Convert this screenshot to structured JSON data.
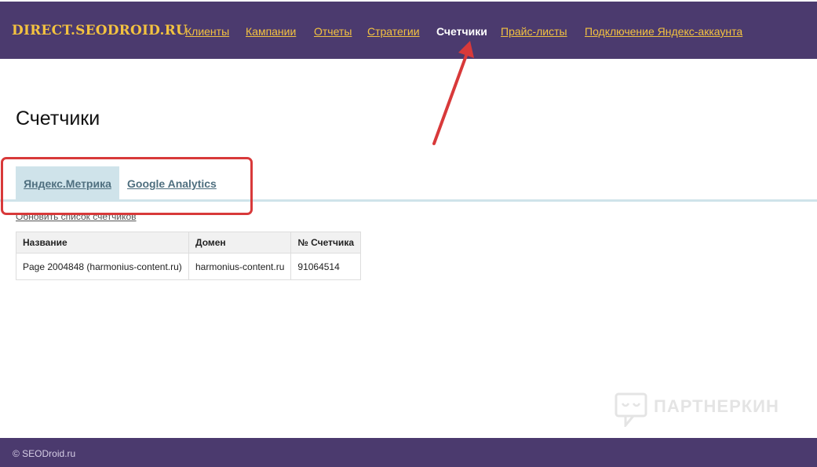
{
  "header": {
    "brand": "DIRECT.SEODROID.RU",
    "nav": [
      {
        "label": "Клиенты"
      },
      {
        "label": "Кампании"
      },
      {
        "label": "Отчеты"
      },
      {
        "label": "Стратегии"
      },
      {
        "label": "Счетчики"
      },
      {
        "label": "Прайс-листы"
      },
      {
        "label": "Подключение Яндекс-аккаунта"
      }
    ]
  },
  "page": {
    "title": "Счетчики",
    "tabs": [
      {
        "label": "Яндекс.Метрика"
      },
      {
        "label": "Google Analytics"
      }
    ],
    "refresh_link": "Обновить список счетчиков"
  },
  "table": {
    "headers": [
      "Название",
      "Домен",
      "№ Счетчика"
    ],
    "rows": [
      [
        "Page 2004848 (harmonius-content.ru)",
        "harmonius-content.ru",
        "91064514"
      ]
    ]
  },
  "footer": {
    "copyright": "© SEODroid.ru"
  },
  "watermark": {
    "text": "ПАРТНЕРКИН"
  },
  "colors": {
    "header_bg": "#4b3a6e",
    "brand_yellow": "#f3c240",
    "tab_active_bg": "#cfe3ea",
    "annotation_red": "#d8393a"
  }
}
